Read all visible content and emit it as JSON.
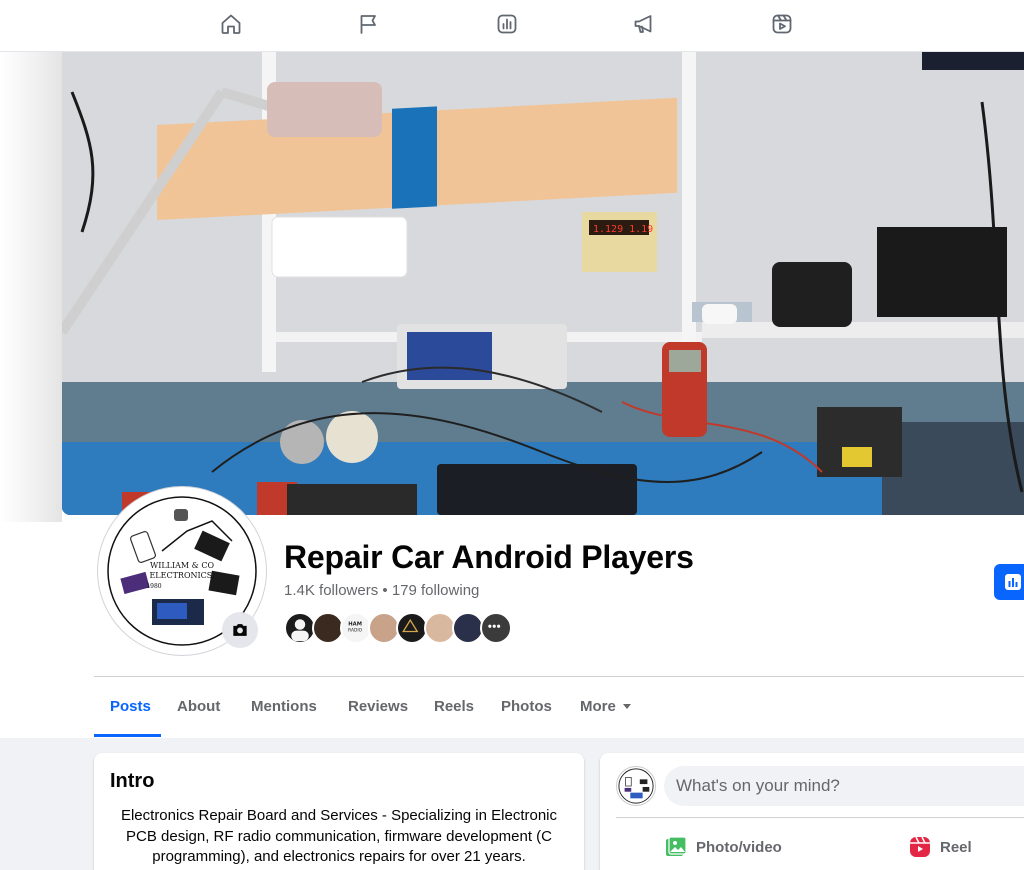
{
  "nav": {
    "icons": [
      "home-icon",
      "flag-icon",
      "insights-icon",
      "megaphone-icon",
      "reels-icon"
    ]
  },
  "page": {
    "name": "Repair Car Android Players",
    "followers": "1.4K followers",
    "separator": " • ",
    "following": "179 following",
    "logo_text_1": "WILLIAM & CO",
    "logo_text_2": "ELECTRONICS.",
    "logo_text_3": "1980",
    "cover_panel_readout": "1.129  1.19"
  },
  "favorites": [
    {
      "label": "follower avatar 1",
      "color": "#1c1c1c"
    },
    {
      "label": "follower avatar 2",
      "color": "#3a2a20"
    },
    {
      "label": "HAM RADIO",
      "color": "#f5f5f5"
    },
    {
      "label": "follower avatar 4",
      "color": "#c9a28a"
    },
    {
      "label": "follower avatar 5",
      "color": "#1a1a1a"
    },
    {
      "label": "follower avatar 6",
      "color": "#d9b8a0"
    },
    {
      "label": "follower avatar 7",
      "color": "#2a2f4a"
    },
    {
      "label": "more",
      "color": "#3b3b3b"
    }
  ],
  "tabs": [
    {
      "label": "Posts",
      "active": true
    },
    {
      "label": "About",
      "active": false
    },
    {
      "label": "Mentions",
      "active": false
    },
    {
      "label": "Reviews",
      "active": false
    },
    {
      "label": "Reels",
      "active": false
    },
    {
      "label": "Photos",
      "active": false
    },
    {
      "label": "More",
      "active": false
    }
  ],
  "intro": {
    "title": "Intro",
    "bio": "Electronics Repair Board and Services - Specializing in Electronic PCB design, RF radio communication, firmware development (C programming), and electronics repairs for over 21 years."
  },
  "composer": {
    "placeholder": "What's on your mind?",
    "photo_label": "Photo/video",
    "reel_label": "Reel"
  },
  "colors": {
    "accent": "#0866ff",
    "muted_text": "#65676b",
    "photo_green": "#45bd62",
    "reel_red": "#e42645"
  }
}
